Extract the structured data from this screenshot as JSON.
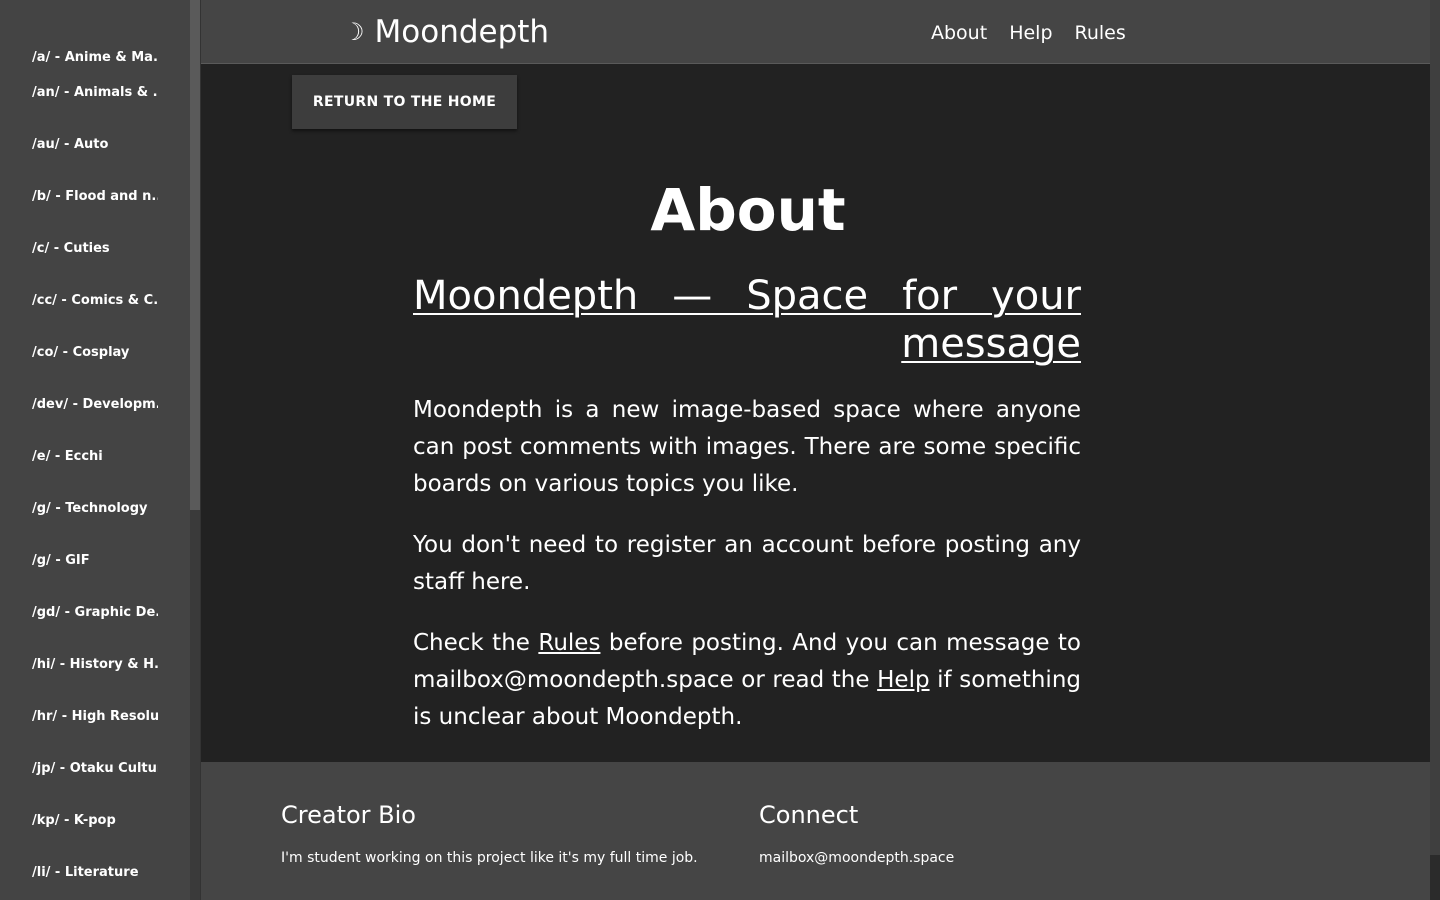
{
  "sidebar": {
    "items": [
      "/a/ - Anime & Ma...",
      "/an/ - Animals & ...",
      "/au/ - Auto",
      "/b/ - Flood and n...",
      "/c/ - Cuties",
      "/cc/ - Comics & C...",
      "/co/ - Cosplay",
      "/dev/ - Developm...",
      "/e/ - Ecchi",
      "/g/ - Technology",
      "/g/ - GIF",
      "/gd/ - Graphic De...",
      "/hi/ - History & H...",
      "/hr/ - High Resolu...",
      "/jp/ - Otaku Culture",
      "/kp/ - K-pop",
      "/li/ - Literature"
    ]
  },
  "header": {
    "brand_icon": "☽",
    "brand": "Moondepth",
    "nav": [
      "About",
      "Help",
      "Rules"
    ]
  },
  "return_button": "RETURN TO THE HOME",
  "main": {
    "title": "About",
    "subtitle": "Moondepth — Space for your message",
    "para1": "Moondepth is a new image-based space where anyone can post comments with images. There are some specific boards on various topics you like.",
    "para2": "You don't need to register an account before posting any staff here.",
    "para3": {
      "t1": "Check the ",
      "rules_link": "Rules",
      "t2": " before posting. And you can message to mailbox@moondepth.space or read the ",
      "help_link": "Help",
      "t3": " if something is unclear about Moondepth."
    }
  },
  "footer": {
    "bio_title": "Creator Bio",
    "bio_text": "I'm student working on this project like it's my full time job.",
    "connect_title": "Connect",
    "connect_email": "mailbox@moondepth.space"
  },
  "colors": {
    "background": "#222222",
    "sidebar": "#444444",
    "header": "#454545",
    "text": "#ffffff"
  }
}
